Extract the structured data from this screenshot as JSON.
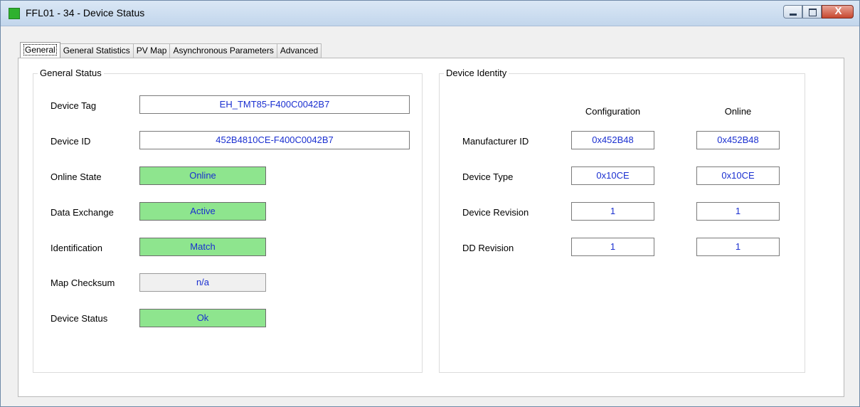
{
  "window": {
    "title": "FFL01 - 34 - Device Status",
    "minimize_label": "",
    "maximize_label": "",
    "close_label": "X",
    "status_icon_color": "#2fb12f"
  },
  "tabs": [
    {
      "label": "General",
      "active": true
    },
    {
      "label": "General Statistics",
      "active": false
    },
    {
      "label": "PV Map",
      "active": false
    },
    {
      "label": "Asynchronous Parameters",
      "active": false
    },
    {
      "label": "Advanced",
      "active": false
    }
  ],
  "general_status": {
    "title": "General Status",
    "rows": [
      {
        "label": "Device Tag",
        "value": "EH_TMT85-F400C0042B7",
        "style": "white"
      },
      {
        "label": "Device ID",
        "value": "452B4810CE-F400C0042B7",
        "style": "white"
      },
      {
        "label": "Online State",
        "value": "Online",
        "style": "green"
      },
      {
        "label": "Data Exchange",
        "value": "Active",
        "style": "green"
      },
      {
        "label": "Identification",
        "value": "Match",
        "style": "green"
      },
      {
        "label": "Map Checksum",
        "value": "n/a",
        "style": "grey"
      },
      {
        "label": "Device Status",
        "value": "Ok",
        "style": "green"
      }
    ]
  },
  "device_identity": {
    "title": "Device Identity",
    "col_configuration": "Configuration",
    "col_online": "Online",
    "rows": [
      {
        "label": "Manufacturer ID",
        "configuration": "0x452B48",
        "online": "0x452B48"
      },
      {
        "label": "Device Type",
        "configuration": "0x10CE",
        "online": "0x10CE"
      },
      {
        "label": "Device Revision",
        "configuration": "1",
        "online": "1"
      },
      {
        "label": "DD Revision",
        "configuration": "1",
        "online": "1"
      }
    ]
  },
  "colors": {
    "value_text": "#1a2fd0",
    "status_green": "#8ee58e",
    "na_grey": "#f0f0f0"
  }
}
